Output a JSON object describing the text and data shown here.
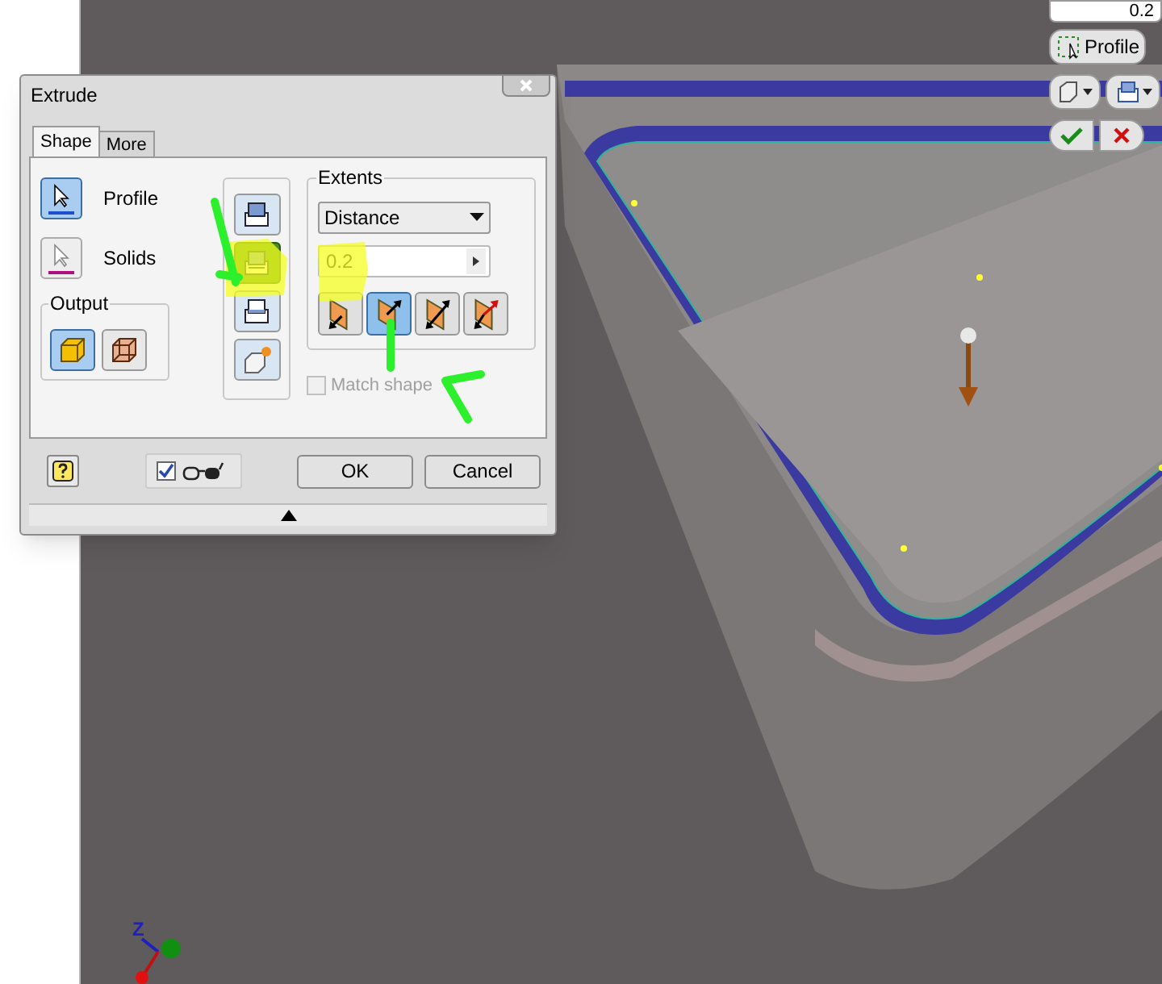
{
  "dialog": {
    "title": "Extrude",
    "tabs": [
      {
        "label": "Shape",
        "selected": true
      },
      {
        "label": "More",
        "selected": false
      }
    ],
    "selectors": [
      {
        "kind": "profile",
        "label": "Profile",
        "selected": true
      },
      {
        "kind": "solids",
        "label": "Solids",
        "selected": false
      }
    ],
    "output": {
      "label": "Output",
      "buttons": [
        {
          "kind": "solid",
          "selected": true
        },
        {
          "kind": "surface",
          "selected": false
        }
      ]
    },
    "operations": [
      {
        "kind": "join",
        "selected": false
      },
      {
        "kind": "cut",
        "selected": true
      },
      {
        "kind": "intersect",
        "selected": false
      },
      {
        "kind": "new_solid",
        "selected": false
      }
    ],
    "extents": {
      "label": "Extents",
      "type": "Distance",
      "distance": "0.2",
      "directions": [
        {
          "kind": "default",
          "selected": false
        },
        {
          "kind": "flipped",
          "selected": true
        },
        {
          "kind": "symmetric",
          "selected": false
        },
        {
          "kind": "asymmetric",
          "selected": false
        }
      ],
      "match_shape": {
        "label": "Match shape",
        "checked": false,
        "disabled": true
      }
    },
    "preview": {
      "checked": true
    },
    "buttons": [
      "OK",
      "Cancel"
    ]
  },
  "mini_toolbar": {
    "value": "0.2",
    "profile_label": "Profile"
  },
  "triad": {
    "axis_label": "Z"
  }
}
